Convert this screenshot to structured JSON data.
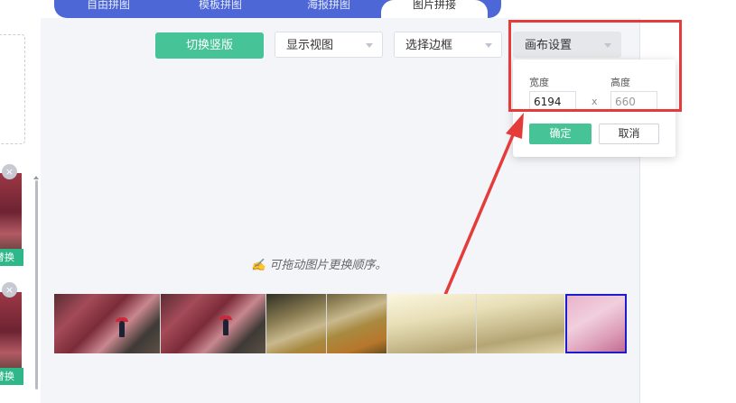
{
  "tabs": [
    "自由拼图",
    "模板拼图",
    "海报拼图",
    "图片拼接"
  ],
  "sidebar": {
    "swap_label": "替换",
    "close_symbol": "×"
  },
  "toolbar": {
    "switch_label": "切换竖版",
    "view_select": "显示视图",
    "border_select": "选择边框",
    "canvas_select": "画布设置"
  },
  "canvas_popover": {
    "width_label": "宽度",
    "height_label": "高度",
    "width_value": "6194",
    "height_value": "660",
    "separator": "x",
    "ok_label": "确定",
    "cancel_label": "取消"
  },
  "hint": "可拖动图片更换顺序。",
  "colors": {
    "tab_bar": "#4d68d6",
    "accent": "#47c497",
    "annotation": "#e43b3b",
    "selected_border": "#1b1bd0"
  }
}
